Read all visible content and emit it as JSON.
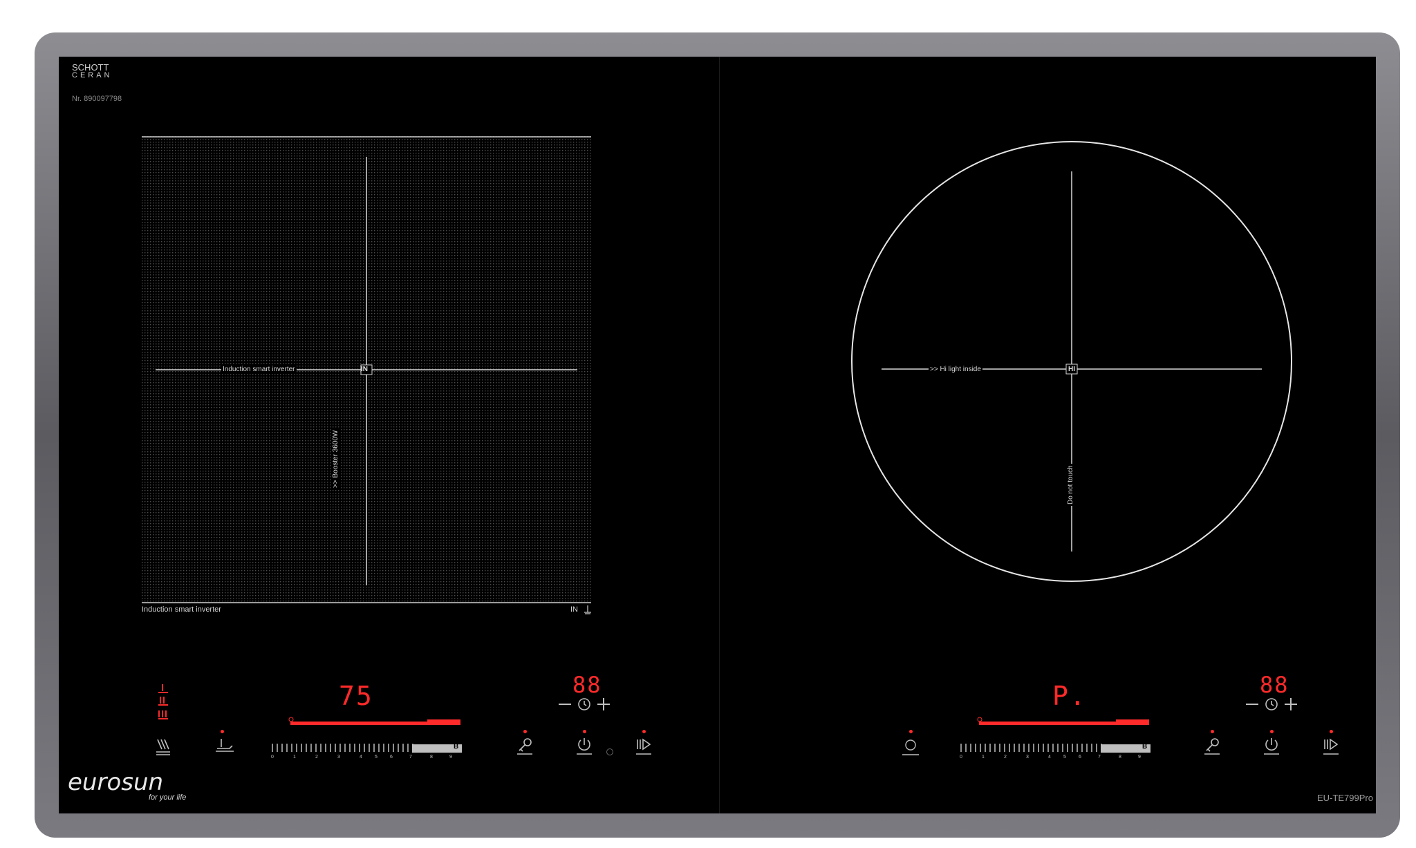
{
  "brand": {
    "glass_maker_line1": "SCHOTT",
    "glass_maker_line2": "CERAN",
    "serial": "Nr. 890097798",
    "logo": "eurosun",
    "tagline": "for your life",
    "model": "EU-TE799Pro"
  },
  "left_zone": {
    "center_label": "IN",
    "horizontal_label": "Induction smart inverter",
    "vertical_label": ">> Booster 3600W",
    "bottom_left_label": "Induction smart inverter",
    "bottom_right_label": "IN"
  },
  "right_zone": {
    "center_label": "HI",
    "horizontal_label": ">> Hi light inside",
    "vertical_label": "Do not touch"
  },
  "left_controls": {
    "power_display": "75",
    "timer_display": "88",
    "slider_levels": [
      "0",
      "1",
      "2",
      "3",
      "4",
      "5",
      "6",
      "7",
      "8",
      "9"
    ],
    "boost_label": "B"
  },
  "right_controls": {
    "power_display": "P.",
    "timer_display": "88",
    "slider_levels": [
      "0",
      "1",
      "2",
      "3",
      "4",
      "5",
      "6",
      "7",
      "8",
      "9"
    ],
    "boost_label": "B"
  },
  "colors": {
    "frame": "#6e6e73",
    "glass": "#000000",
    "display": "#ff2a2a",
    "print": "#bfbfbf"
  }
}
